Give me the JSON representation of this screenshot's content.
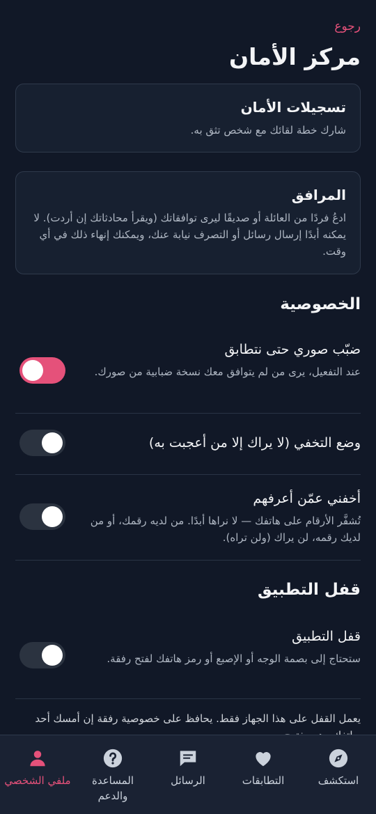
{
  "header": {
    "back_label": "رجوع",
    "title": "مركز الأمان"
  },
  "cards": [
    {
      "title": "تسجيلات الأمان",
      "description": "شارك خطة لقائك مع شخص تثق به."
    },
    {
      "title": "المرافق",
      "description": "ادعُ فردًا من العائلة أو صديقًا ليرى توافقاتك (ويقرأ محادثاتك إن أردت). لا يمكنه أبدًا إرسال رسائل أو التصرف نيابة عنك، ويمكنك إنهاء ذلك في أي وقت."
    }
  ],
  "privacy": {
    "section_title": "الخصوصية",
    "items": [
      {
        "title": "ضبّب صوري حتى نتطابق",
        "description": "عند التفعيل، يرى من لم يتوافق معك نسخة ضبابية من صورك.",
        "enabled": true
      },
      {
        "title": "وضع التخفي (لا يراك إلا من أعجبت به)",
        "description": "",
        "enabled": false
      },
      {
        "title": "أخفني عمّن أعرفهم",
        "description": "تُشفَّر الأرقام على هاتفك — لا نراها أبدًا. من لديه رقمك، أو من لديك رقمه، لن يراك (ولن تراه).",
        "enabled": false
      }
    ]
  },
  "app_lock": {
    "section_title": "قفل التطبيق",
    "item": {
      "title": "قفل التطبيق",
      "description": "ستحتاج إلى بصمة الوجه أو الإصبع أو رمز هاتفك لفتح رفقة.",
      "enabled": false
    },
    "footnote": "يعمل القفل على هذا الجهاز فقط. يحافظ على خصوصية رفقة إن أمسك أحد بهاتفك وهو مفتوح."
  },
  "bottom_nav": {
    "items": [
      {
        "key": "profile",
        "label": "ملفي الشخصي",
        "icon": "person-icon",
        "active": true
      },
      {
        "key": "help",
        "label": "المساعدة والدعم",
        "icon": "help-icon",
        "active": false
      },
      {
        "key": "messages",
        "label": "الرسائل",
        "icon": "chat-icon",
        "active": false
      },
      {
        "key": "matches",
        "label": "التطابقات",
        "icon": "heart-icon",
        "active": false
      },
      {
        "key": "explore",
        "label": "استكشف",
        "icon": "compass-icon",
        "active": false
      }
    ]
  },
  "colors": {
    "accent": "#e5517a",
    "background": "#111827",
    "card": "#172030",
    "toggle_off": "#2b3340"
  }
}
